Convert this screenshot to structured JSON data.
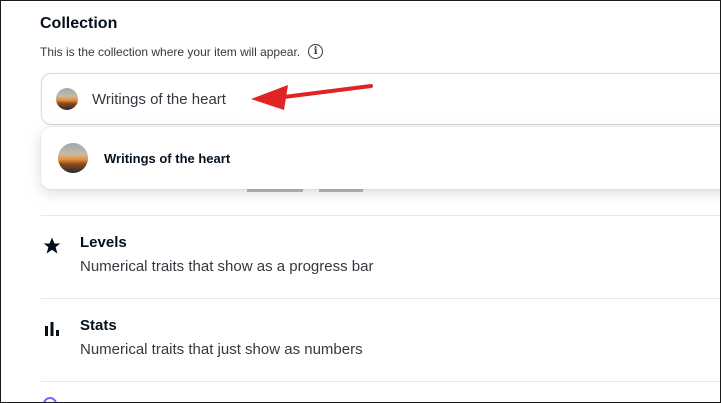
{
  "collection": {
    "title": "Collection",
    "description": "This is the collection where your item will appear.",
    "info_icon": "info-icon",
    "selected_value": "Writings of the heart",
    "dropdown_option": "Writings of the heart"
  },
  "traits": [
    {
      "icon": "star-icon",
      "title": "Levels",
      "description": "Numerical traits that show as a progress bar"
    },
    {
      "icon": "bar-chart-icon",
      "title": "Stats",
      "description": "Numerical traits that just show as numbers"
    }
  ],
  "annotation": {
    "arrow_color": "#e02424"
  }
}
